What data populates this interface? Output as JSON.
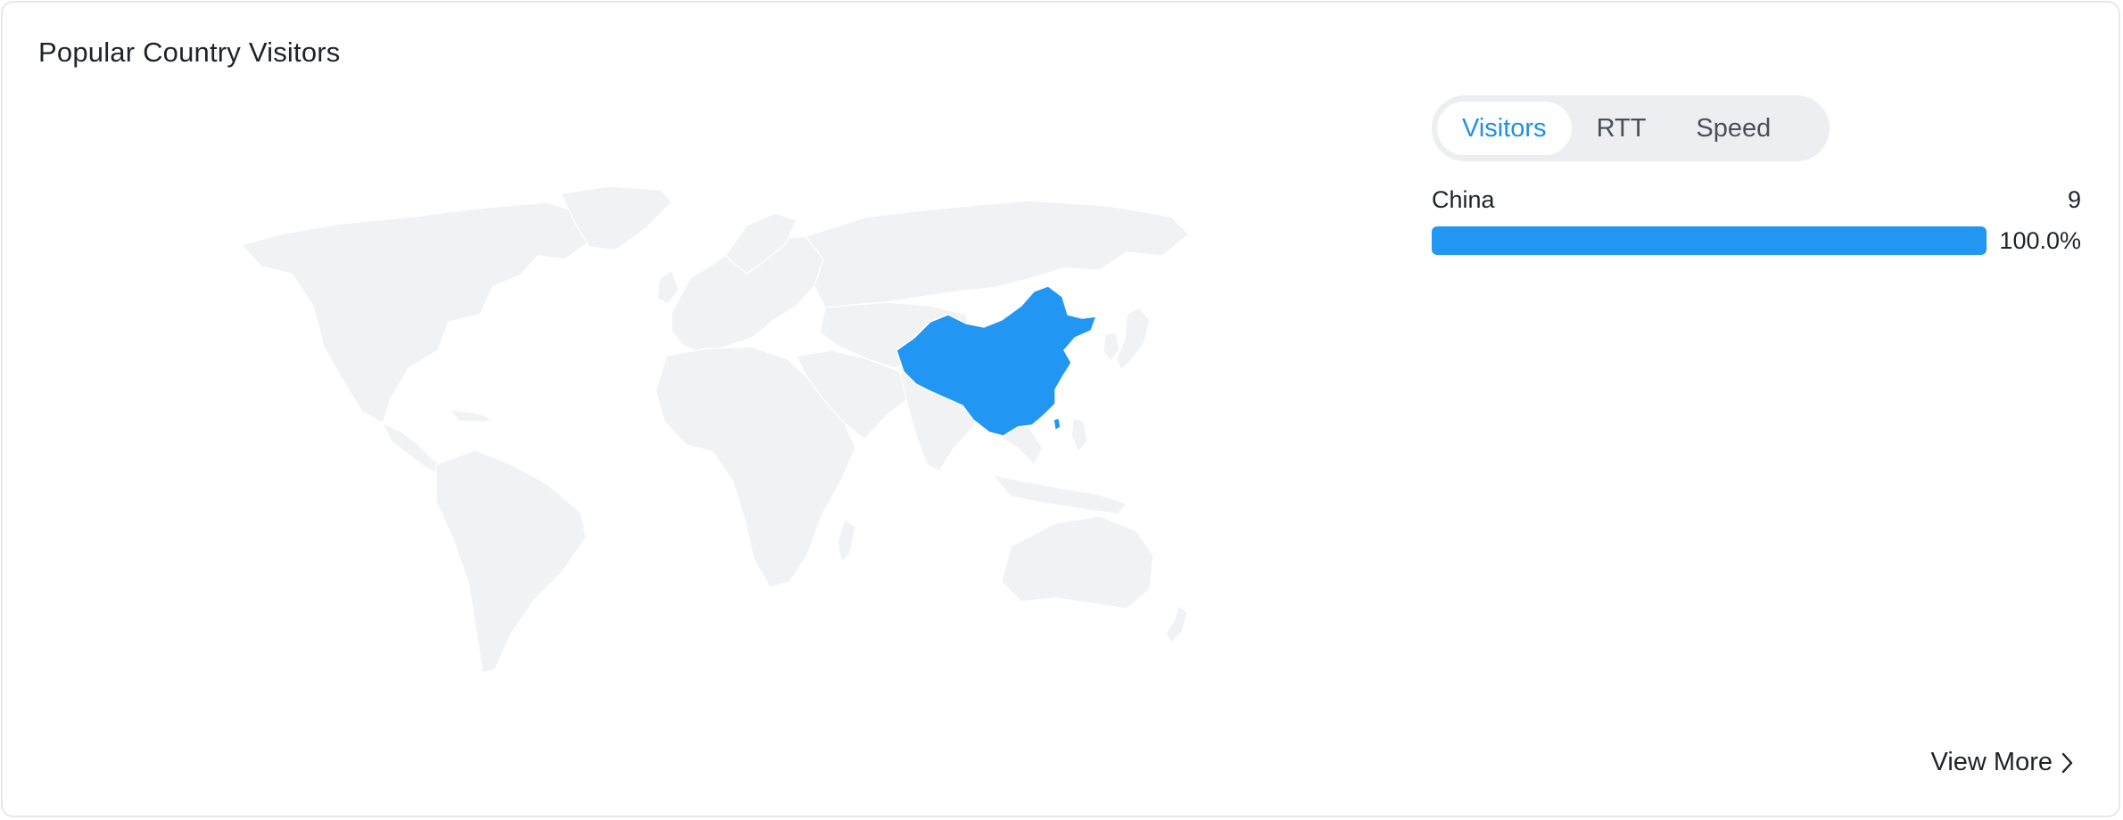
{
  "card": {
    "title": "Popular Country Visitors"
  },
  "map": {
    "highlighted_country": "China",
    "highlight_color": "#2196f3",
    "land_color": "#f1f2f4"
  },
  "tabs": [
    {
      "label": "Visitors",
      "active": true
    },
    {
      "label": "RTT",
      "active": false
    },
    {
      "label": "Speed",
      "active": false
    }
  ],
  "ranking": [
    {
      "country": "China",
      "count": "9",
      "percent_label": "100.0%",
      "percent": 100
    }
  ],
  "footer": {
    "view_more_label": "View More",
    "view_more_icon": "chevron-right-icon"
  },
  "colors": {
    "accent": "#1f8ff0",
    "bar": "#2196f3",
    "border": "#e6e8ec"
  }
}
